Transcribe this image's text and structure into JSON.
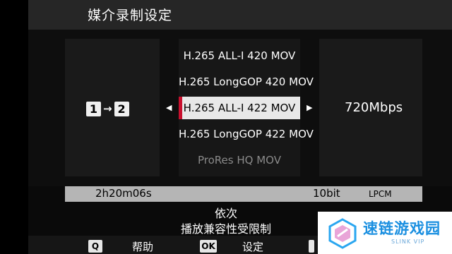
{
  "header": {
    "title": "媒介录制设定",
    "icon": "movie-camera-icon"
  },
  "slot": {
    "from": "1",
    "to": "2",
    "arrow": "→"
  },
  "options": [
    {
      "label": "H.265 ALL-I 420 MOV",
      "state": "normal"
    },
    {
      "label": "H.265 LongGOP 420 MOV",
      "state": "normal"
    },
    {
      "label": "H.265 ALL-I 422 MOV",
      "state": "selected"
    },
    {
      "label": "H.265 LongGOP 422 MOV",
      "state": "normal"
    },
    {
      "label": "ProRes HQ MOV",
      "state": "dim"
    }
  ],
  "nav": {
    "left": "◀",
    "right": "▶"
  },
  "bitrate": "720Mbps",
  "status": {
    "time": "2h20m06s",
    "bit_depth": "10bit",
    "audio": "LPCM"
  },
  "message": {
    "line1": "依次",
    "line2": "播放兼容性受限制"
  },
  "keys": {
    "q_key": "Q",
    "help_label": "帮助",
    "ok_key": "OK",
    "set_label": "设定"
  },
  "watermark": {
    "text": "速链游戏园",
    "sub": "SLINK VIP"
  },
  "colors": {
    "accent": "#c8102e",
    "selected_bg": "#e8e8e8",
    "status_bg": "#b5b5b5"
  }
}
